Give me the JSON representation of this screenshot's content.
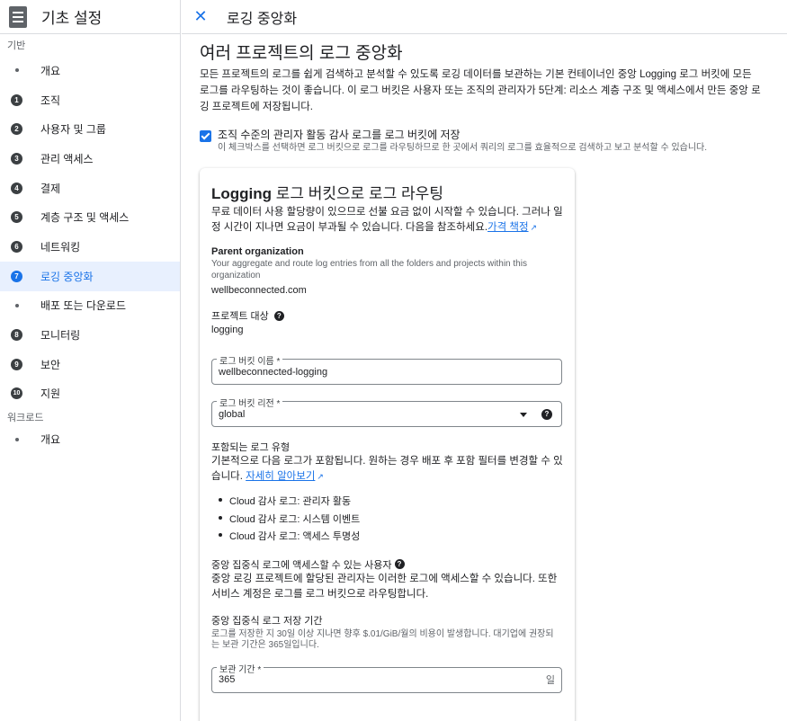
{
  "sidebar": {
    "title": "기초 설정",
    "section_basics": "기반",
    "section_workload": "워크로드",
    "items": [
      {
        "num": "",
        "label": "개요"
      },
      {
        "num": "1",
        "label": "조직"
      },
      {
        "num": "2",
        "label": "사용자 및 그룹"
      },
      {
        "num": "3",
        "label": "관리 액세스"
      },
      {
        "num": "4",
        "label": "결제"
      },
      {
        "num": "5",
        "label": "계층 구조 및 액세스"
      },
      {
        "num": "6",
        "label": "네트워킹"
      },
      {
        "num": "7",
        "label": "로깅 중앙화"
      },
      {
        "num": "",
        "label": "배포 또는 다운로드"
      },
      {
        "num": "8",
        "label": "모니터링"
      },
      {
        "num": "9",
        "label": "보안"
      },
      {
        "num": "10",
        "label": "지원"
      }
    ],
    "workload_items": [
      {
        "label": "개요"
      }
    ],
    "active_index": 7
  },
  "topbar": {
    "close_icon": "close-icon",
    "title": "로깅 중앙화"
  },
  "main": {
    "title": "여러 프로젝트의 로그 중앙화",
    "intro": "모든 프로젝트의 로그를 쉽게 검색하고 분석할 수 있도록 로깅 데이터를 보관하는 기본 컨테이너인 중앙 Logging 로그 버킷에 모든 로그를 라우팅하는 것이 좋습니다. 이 로그 버킷은 사용자 또는 조직의 관리자가 5단계: 리소스 계층 구조 및 액세스에서 만든 중앙 로깅 프로젝트에 저장됩니다.",
    "checkbox": {
      "checked": true,
      "label": "조직 수준의 관리자 활동 감사 로그를 로그 버킷에 저장",
      "help": "이 체크박스를 선택하면 로그 버킷으로 로그를 라우팅하므로 한 곳에서 쿼리의 로그를 효율적으로 검색하고 보고 분석할 수 있습니다."
    },
    "card": {
      "title_bold": "Logging",
      "title_rest": " 로그 버킷으로 로그 라우팅",
      "desc": "무료 데이터 사용 할당량이 있으므로 선불 요금 없이 시작할 수 있습니다. 그러나 일정 시간이 지나면 요금이 부과될 수 있습니다. 다음을 참조하세요.",
      "pricing_link": "가격 책정",
      "parent_org_label": "Parent organization",
      "parent_org_help": "Your aggregate and route log entries from all the folders and projects within this organization",
      "parent_org_value": "wellbeconnected.com",
      "project_label": "프로젝트 대상",
      "project_value": "logging",
      "bucket_name_label": "로그 버킷 이름 *",
      "bucket_name_value": "wellbeconnected-logging",
      "bucket_region_label": "로그 버킷 리전 *",
      "bucket_region_value": "global",
      "included_title": "포함되는 로그 유형",
      "included_text": "기본적으로 다음 로그가 포함됩니다. 원하는 경우 배포 후 포함 필터를 변경할 수 있습니다.",
      "learn_more_link": "자세히 알아보기",
      "log_types": [
        "Cloud 감사 로그: 관리자 활동",
        "Cloud 감사 로그: 시스템 이벤트",
        "Cloud 감사 로그: 액세스 투명성"
      ],
      "access_title": "중앙 집중식 로그에 액세스할 수 있는 사용자",
      "access_text": "중앙 로깅 프로젝트에 할당된 관리자는 이러한 로그에 액세스할 수 있습니다. 또한 서비스 계정은 로그를 로그 버킷으로 라우팅합니다.",
      "retention_title": "중앙 집중식 로그 저장 기간",
      "retention_help": "로그를 저장한 지 30일 이상 지나면 향후 $.01/GiB/월의 비용이 발생합니다. 대기업에 권장되는 보관 기간은 365일입니다.",
      "retention_label": "보관 기간 *",
      "retention_value": "365",
      "retention_suffix": "일"
    }
  }
}
